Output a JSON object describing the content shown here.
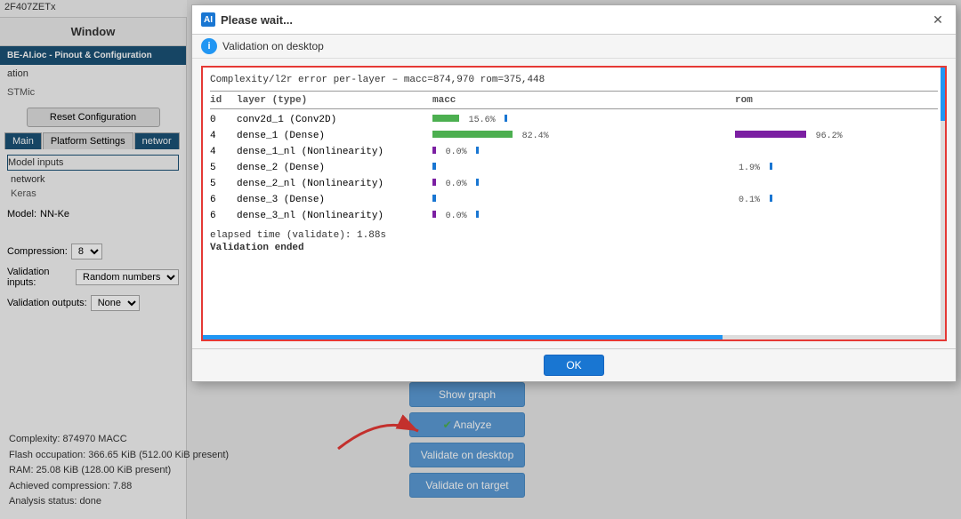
{
  "app": {
    "top_bar_label": "2F407ZETx",
    "window_title": "Window",
    "sidebar_title": "BE-AI.ioc - Pinout & Configuration",
    "section_label": "ation",
    "stm_label": "STMic",
    "reset_btn": "Reset Configuration",
    "tabs": [
      "Main",
      "Platform Settings",
      "networ"
    ],
    "model_inputs_label": "Model inputs",
    "model_input_value": "network",
    "keras_value": "Keras",
    "model_label": "Model:",
    "model_value": "NN-Ke",
    "compression_label": "Compression:",
    "compression_value": "8",
    "validation_inputs_label": "Validation inputs:",
    "validation_inputs_value": "Random numbers",
    "validation_outputs_label": "Validation outputs:",
    "validation_outputs_value": "None",
    "complexity_line": "Complexity: 874970 MACC",
    "flash_line": "Flash occupation: 366.65 KiB (512.00 KiB present)",
    "ram_line": "RAM: 25.08 KiB (128.00 KiB present)",
    "achieved_line": "Achieved compression: 7.88",
    "analysis_line": "Analysis status: done"
  },
  "buttons": {
    "show_graph": "Show graph",
    "analyze": "Analyze",
    "validate_desktop": "Validate on desktop",
    "validate_target": "Validate on target"
  },
  "dialog": {
    "title": "Please wait...",
    "close_label": "✕",
    "info_text": "Validation on desktop",
    "ok_btn": "OK",
    "complexity_header": "Complexity/l2r error per-layer – macc=874,970 rom=375,448",
    "table_headers": {
      "id": "id",
      "layer": "layer (type)",
      "macc": "macc",
      "rom": "rom"
    },
    "rows": [
      {
        "id": "0",
        "layer": "conv2d_1 (Conv2D)",
        "macc_bar_type": "green_small",
        "macc_pct": "15.6%",
        "rom_bar_type": "blue_tiny",
        "rom_pct": ""
      },
      {
        "id": "4",
        "layer": "dense_1 (Dense)",
        "macc_bar_type": "green_large",
        "macc_pct": "82.4%",
        "rom_bar_type": "purple_large",
        "rom_pct": "96.2%"
      },
      {
        "id": "4",
        "layer": "dense_1_nl (Nonlinearity)",
        "macc_bar_type": "purple_tiny",
        "macc_pct": "0.0%",
        "rom_bar_type": "blue_tiny",
        "rom_pct": ""
      },
      {
        "id": "5",
        "layer": "dense_2 (Dense)",
        "macc_bar_type": "blue_tiny",
        "macc_pct": "",
        "rom_bar_type": "none",
        "rom_pct": "1.9%"
      },
      {
        "id": "5",
        "layer": "dense_2_nl (Nonlinearity)",
        "macc_bar_type": "purple_tiny",
        "macc_pct": "0.0%",
        "rom_bar_type": "blue_tiny",
        "rom_pct": ""
      },
      {
        "id": "6",
        "layer": "dense_3 (Dense)",
        "macc_bar_type": "blue_tiny",
        "macc_pct": "",
        "rom_bar_type": "none",
        "rom_pct": "0.1%"
      },
      {
        "id": "6",
        "layer": "dense_3_nl (Nonlinearity)",
        "macc_bar_type": "purple_tiny",
        "macc_pct": "0.0%",
        "rom_bar_type": "blue_tiny",
        "rom_pct": ""
      }
    ],
    "elapsed": "elapsed time (validate): 1.88s",
    "validation_ended": "Validation ended"
  },
  "icons": {
    "dialog_icon_text": "AI",
    "info_icon_text": "i",
    "checkmark": "✔"
  }
}
